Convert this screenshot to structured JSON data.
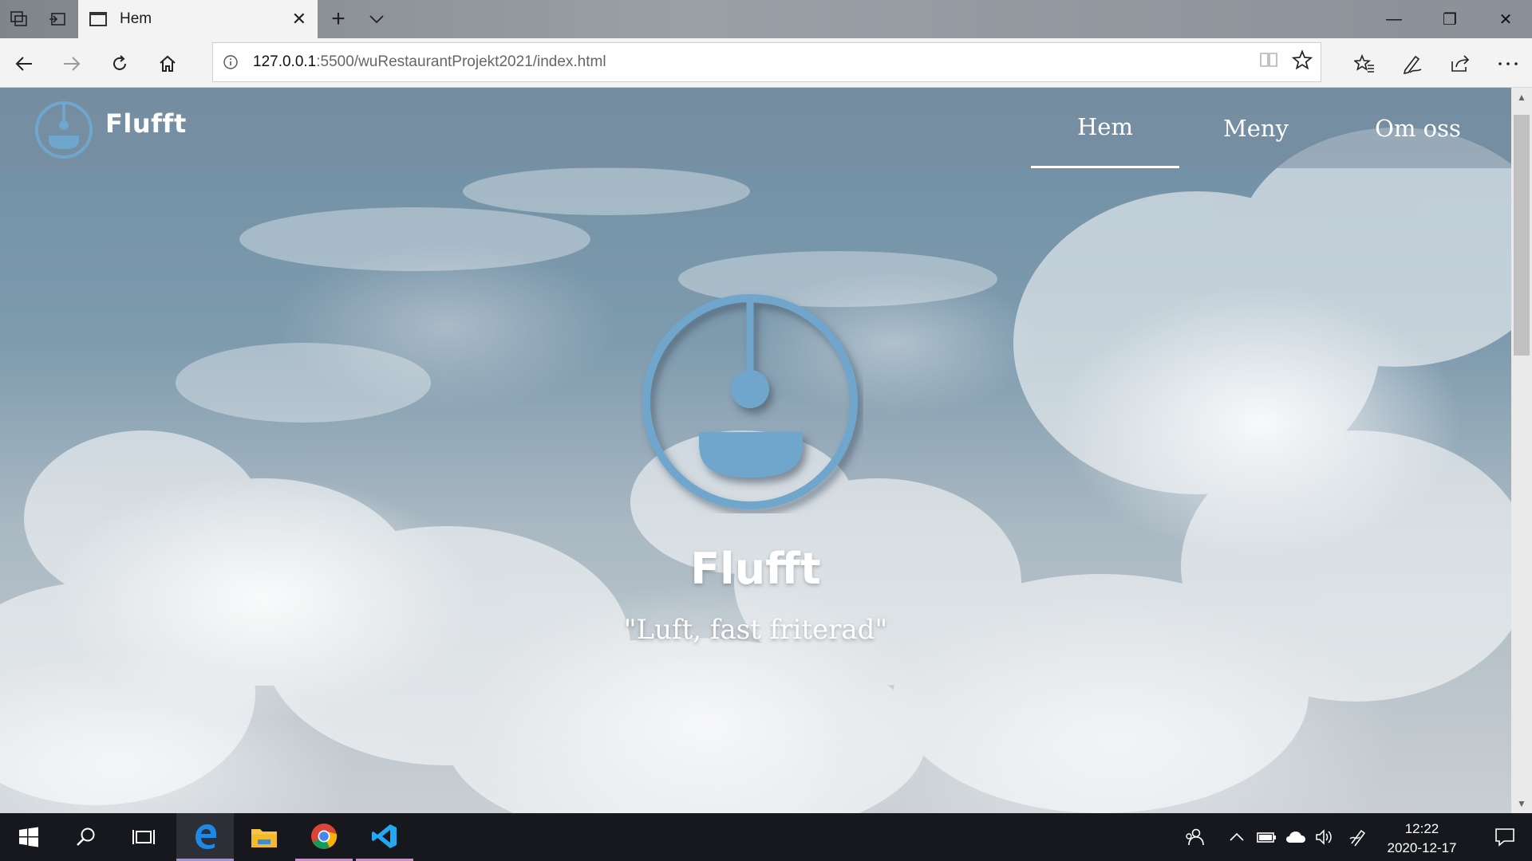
{
  "browser": {
    "tab_title": "Hem",
    "url_host": "127.0.0.1",
    "url_rest": ":5500/wuRestaurantProjekt2021/index.html",
    "tab_close_glyph": "✕",
    "new_tab_glyph": "+",
    "tab_list_glyph": "⌄",
    "minimize_glyph": "—",
    "restore_glyph": "❐",
    "close_glyph": "✕"
  },
  "site": {
    "brand": "Flufft",
    "nav": [
      {
        "label": "Hem",
        "active": true
      },
      {
        "label": "Meny",
        "active": false
      },
      {
        "label": "Om oss",
        "active": false
      }
    ],
    "hero": {
      "brand": "Flufft",
      "tagline": "\"Luft, fast friterad\""
    },
    "colors": {
      "logo_blue": "#6fa6cc",
      "header_overlay": "#788c9e"
    }
  },
  "taskbar": {
    "time": "12:22",
    "date": "2020-12-17",
    "apps": [
      "windows-start-icon",
      "search-icon",
      "task-view-icon",
      "edge-icon",
      "file-explorer-icon",
      "chrome-icon",
      "vscode-icon"
    ]
  }
}
